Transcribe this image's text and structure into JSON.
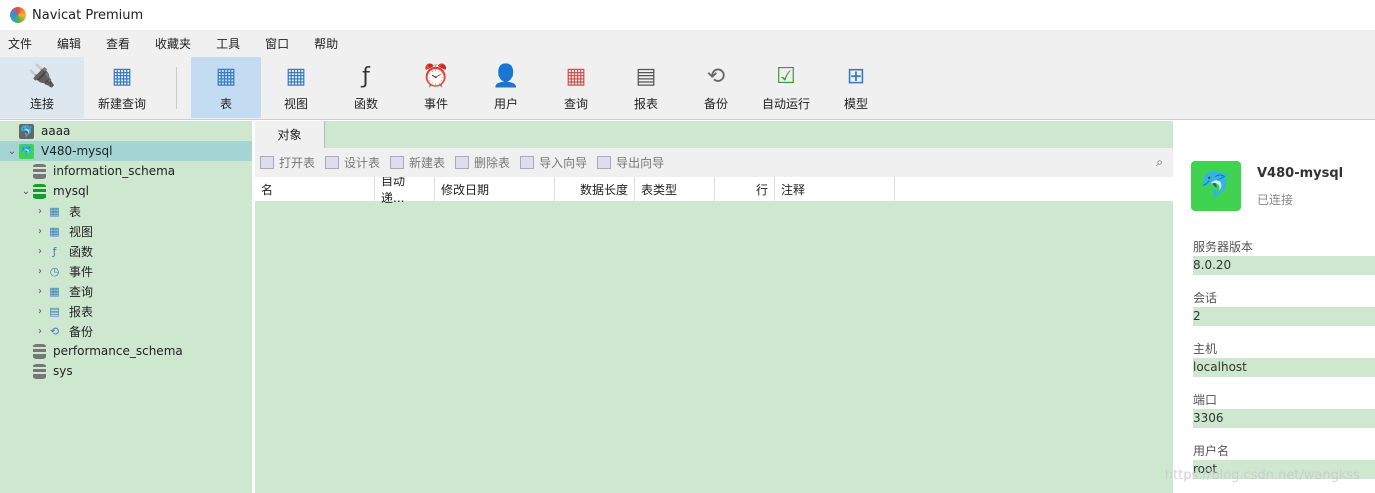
{
  "app_title": "Navicat Premium",
  "menu": [
    "文件",
    "编辑",
    "查看",
    "收藏夹",
    "工具",
    "窗口",
    "帮助"
  ],
  "toolbar": {
    "connect": "连接",
    "new_query": "新建查询",
    "items": [
      "表",
      "视图",
      "函数",
      "事件",
      "用户",
      "查询",
      "报表",
      "备份",
      "自动运行",
      "模型"
    ],
    "selected": "表"
  },
  "tree": [
    {
      "label": "aaaa",
      "level": 0,
      "type": "connection-off"
    },
    {
      "label": "V480-mysql",
      "level": 0,
      "type": "connection-on",
      "expanded": true,
      "selected": true
    },
    {
      "label": "information_schema",
      "level": 1,
      "type": "db"
    },
    {
      "label": "mysql",
      "level": 1,
      "type": "db-open",
      "expanded": true
    },
    {
      "label": "表",
      "level": 2,
      "type": "table"
    },
    {
      "label": "视图",
      "level": 2,
      "type": "view"
    },
    {
      "label": "函数",
      "level": 2,
      "type": "function"
    },
    {
      "label": "事件",
      "level": 2,
      "type": "event"
    },
    {
      "label": "查询",
      "level": 2,
      "type": "query"
    },
    {
      "label": "报表",
      "level": 2,
      "type": "report"
    },
    {
      "label": "备份",
      "level": 2,
      "type": "backup"
    },
    {
      "label": "performance_schema",
      "level": 1,
      "type": "db"
    },
    {
      "label": "sys",
      "level": 1,
      "type": "db"
    }
  ],
  "tabs": [
    "对象"
  ],
  "object_toolbar": [
    "打开表",
    "设计表",
    "新建表",
    "删除表",
    "导入向导",
    "导出向导"
  ],
  "columns": [
    "名",
    "自动递...",
    "修改日期",
    "数据长度",
    "表类型",
    "行",
    "注释"
  ],
  "info": {
    "name": "V480-mysql",
    "status": "已连接",
    "props": [
      {
        "k": "服务器版本",
        "v": "8.0.20"
      },
      {
        "k": "会话",
        "v": "2"
      },
      {
        "k": "主机",
        "v": "localhost"
      },
      {
        "k": "端口",
        "v": "3306"
      },
      {
        "k": "用户名",
        "v": "root"
      }
    ]
  },
  "watermark": "https://blog.csdn.net/wangkss"
}
